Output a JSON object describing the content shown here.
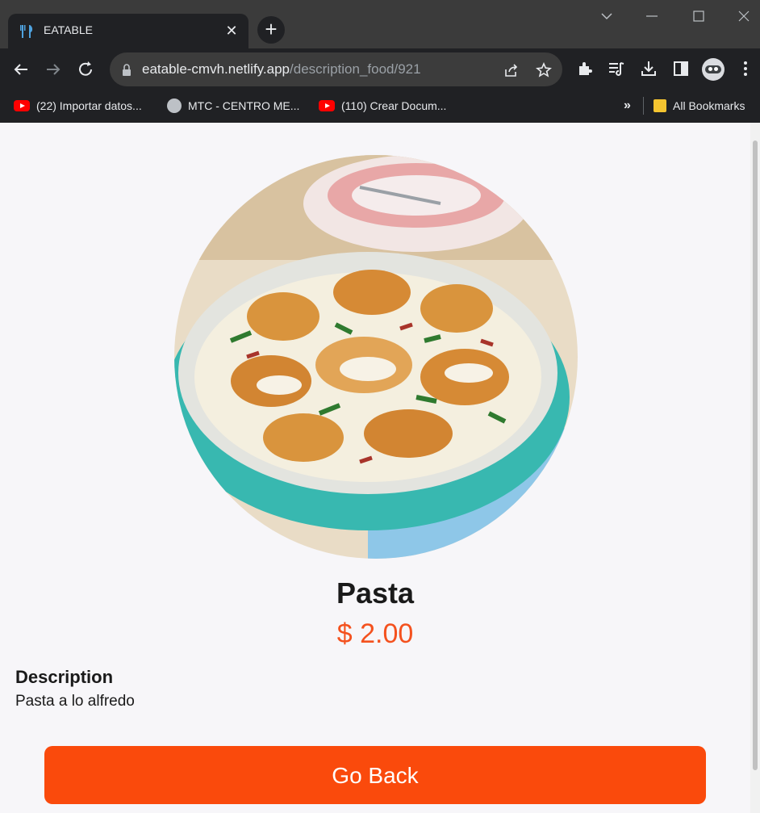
{
  "browser": {
    "tab_title": "EATABLE",
    "url_host": "eatable-cmvh.netlify.app",
    "url_path": "/description_food/921",
    "bookmarks": [
      {
        "label": "(22) Importar datos...",
        "icon": "youtube-icon"
      },
      {
        "label": "MTC - CENTRO ME...",
        "icon": "globe-icon"
      },
      {
        "label": "(110) Crear Docum...",
        "icon": "youtube-icon"
      }
    ],
    "more_bookmarks": "»",
    "all_bookmarks": "All Bookmarks"
  },
  "food": {
    "name": "Pasta",
    "price": "$ 2.00",
    "description_label": "Description",
    "description": "Pasta a lo alfredo"
  },
  "actions": {
    "back_label": "Go Back"
  },
  "colors": {
    "accent": "#fa4a0c",
    "price": "#f4511e"
  }
}
